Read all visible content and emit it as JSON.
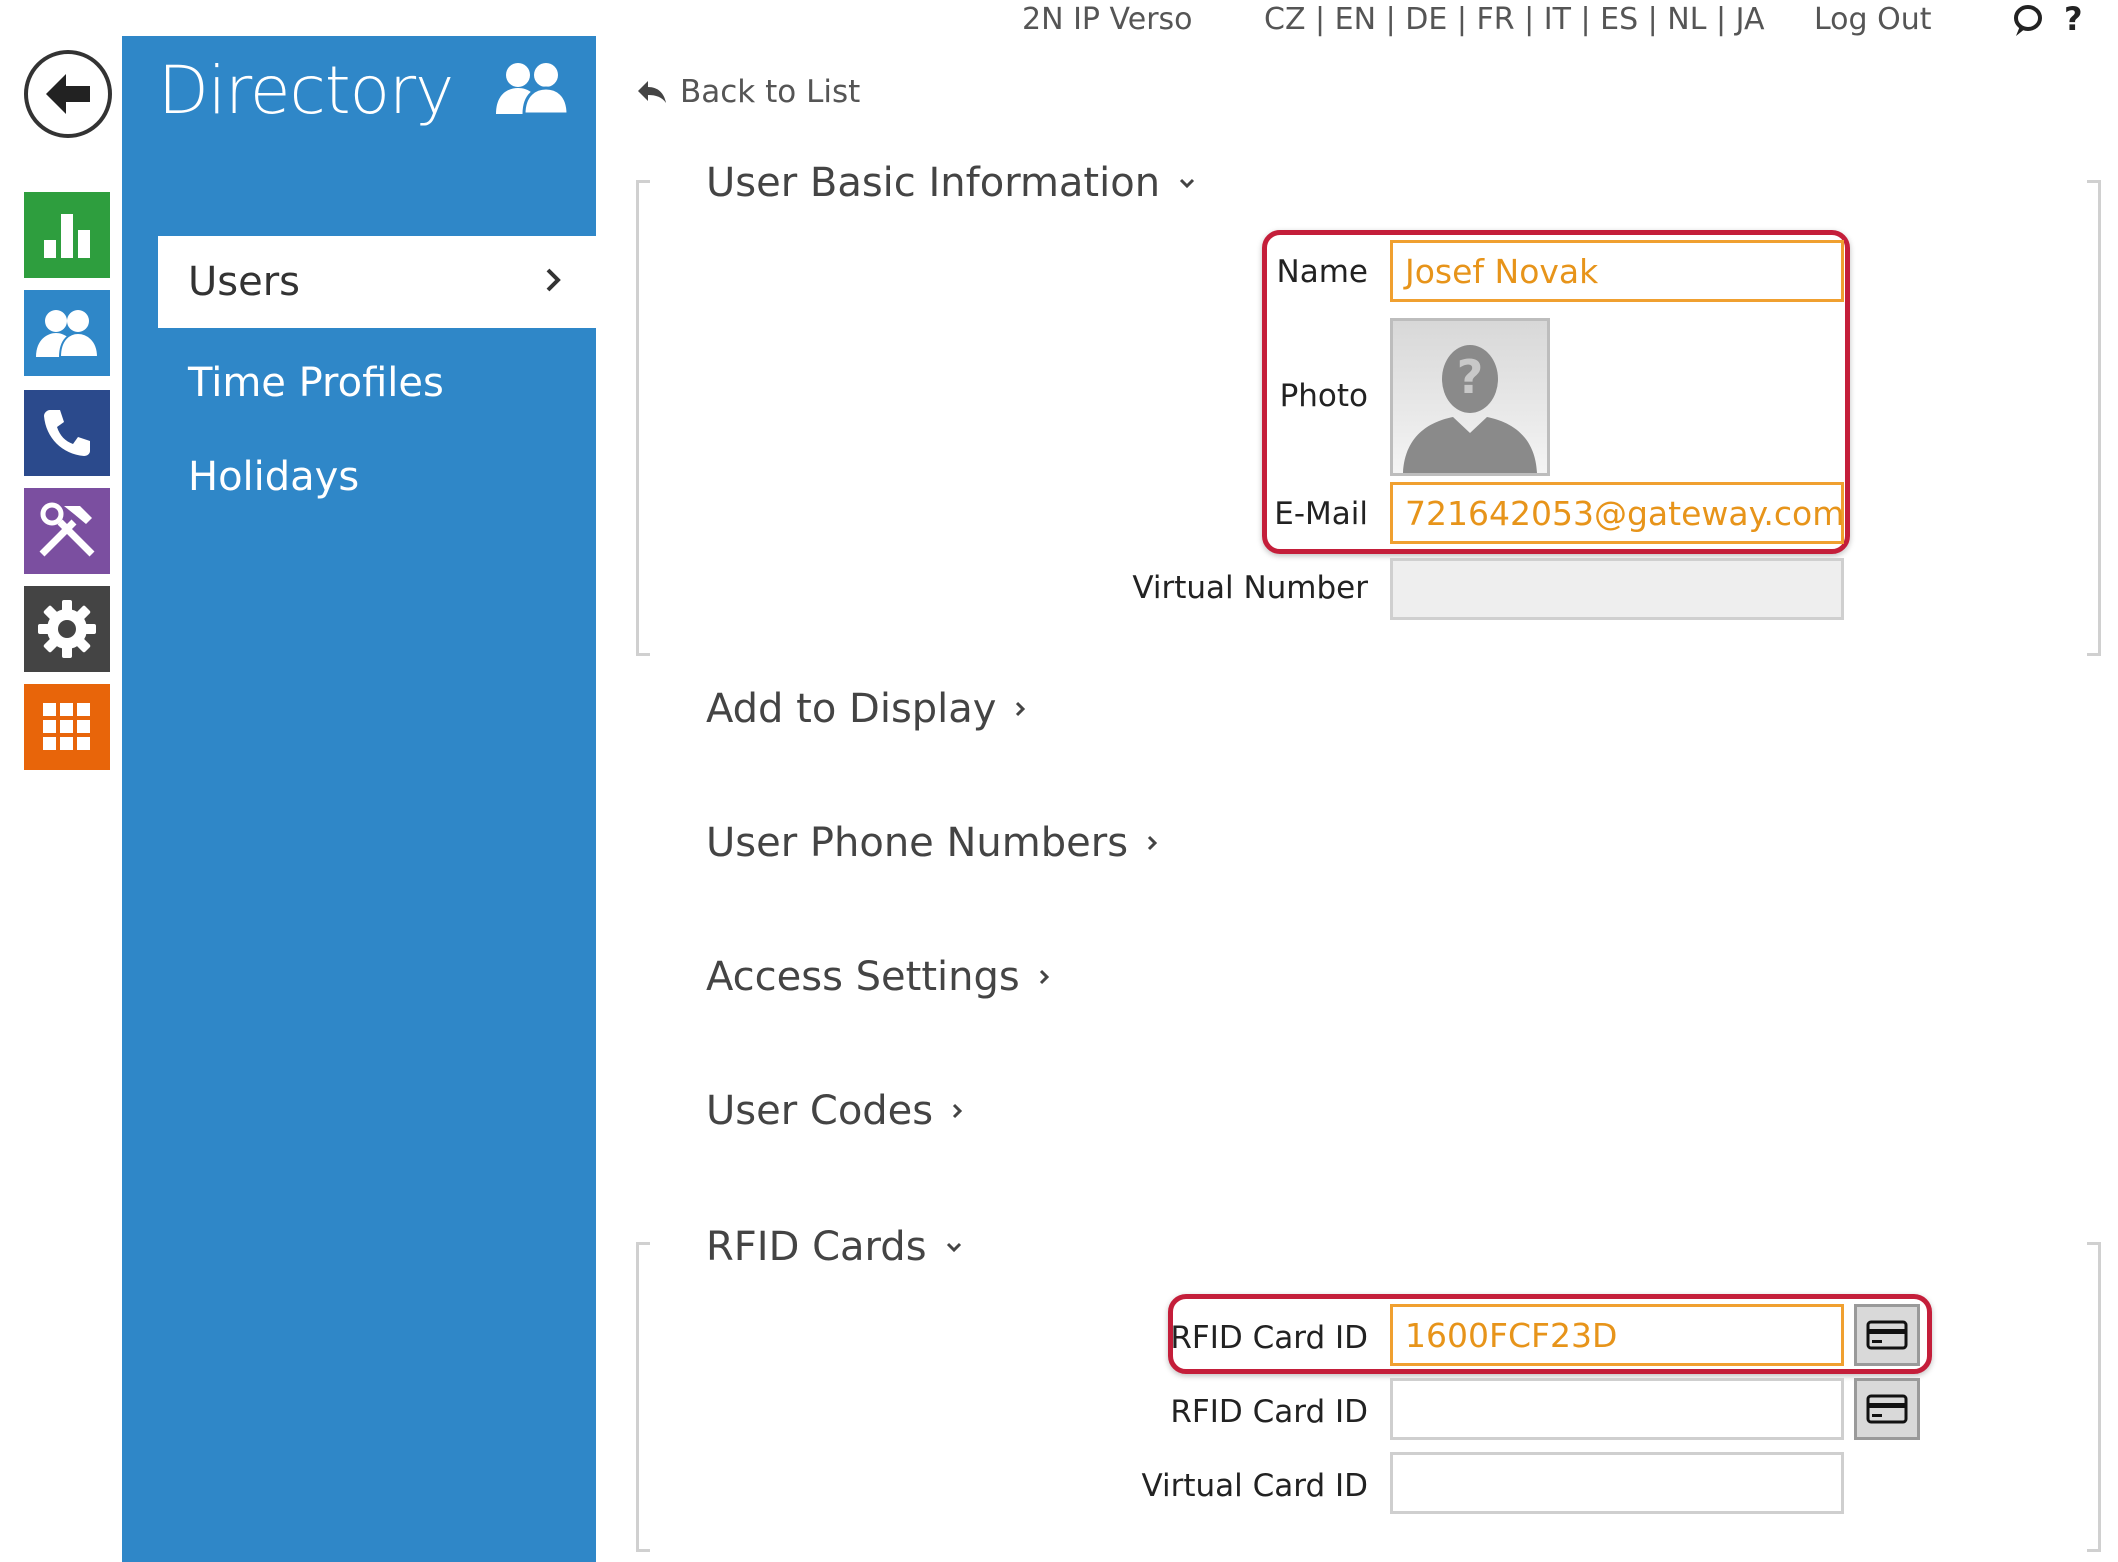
{
  "topbar": {
    "device": "2N IP Verso",
    "languages": "CZ | EN | DE | FR | IT | ES | NL | JA",
    "logout": "Log Out",
    "help": "?"
  },
  "menu": {
    "title": "Directory",
    "items": [
      {
        "label": "Users"
      },
      {
        "label": "Time Profiles"
      },
      {
        "label": "Holidays"
      }
    ]
  },
  "rail": [
    {
      "icon": "status-chart-icon",
      "color": "#2e9e3e"
    },
    {
      "icon": "directory-users-icon",
      "color": "#2f87c8"
    },
    {
      "icon": "phone-icon",
      "color": "#2b4a8c"
    },
    {
      "icon": "tools-icon",
      "color": "#7b4fa0"
    },
    {
      "icon": "gear-icon",
      "color": "#444444"
    },
    {
      "icon": "apps-grid-icon",
      "color": "#e8650a"
    }
  ],
  "back_to_list": "Back to List",
  "sections": {
    "basic": {
      "title": "User Basic Information",
      "name_label": "Name",
      "name_value": "Josef Novak",
      "photo_label": "Photo",
      "email_label": "E-Mail",
      "email_value": "721642053@gateway.com",
      "virtual_number_label": "Virtual Number",
      "virtual_number_value": ""
    },
    "add_to_display": {
      "title": "Add to Display"
    },
    "phone_numbers": {
      "title": "User Phone Numbers"
    },
    "access_settings": {
      "title": "Access Settings"
    },
    "user_codes": {
      "title": "User Codes"
    },
    "rfid": {
      "title": "RFID Cards",
      "card1_label": "RFID Card ID",
      "card1_value": "1600FCF23D",
      "card2_label": "RFID Card ID",
      "card2_value": "",
      "virtual_card_label": "Virtual Card ID",
      "virtual_card_value": ""
    }
  },
  "colors": {
    "menu_blue": "#2f87c8",
    "highlight_red": "#c41e3a",
    "field_orange": "#f0a030",
    "value_orange": "#e7941a"
  }
}
